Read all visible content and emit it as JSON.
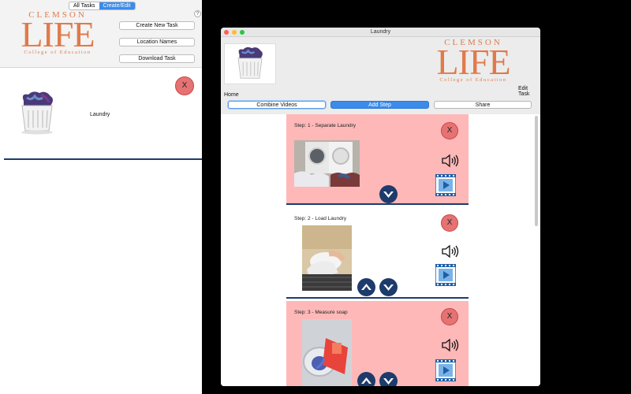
{
  "left_window": {
    "tabs": [
      {
        "label": "All Tasks",
        "active": false
      },
      {
        "label": "Create/Edit",
        "active": true
      }
    ],
    "help_label": "?",
    "logo": {
      "line1": "CLEMSON",
      "line2": "LIFE",
      "line3": "College of Education"
    },
    "buttons": {
      "create_new_task": "Create New Task",
      "location_names": "Location Names",
      "download_task": "Download Task"
    },
    "tasks": [
      {
        "name": "Laundry",
        "delete_label": "X"
      }
    ]
  },
  "right_window": {
    "window_title": "Laundry",
    "logo": {
      "line1": "CLEMSON",
      "line2": "LIFE",
      "line3": "College of Education"
    },
    "edit_task_label": "Edit Task",
    "home_label": "Home",
    "toolbar": {
      "combine_videos": "Combine Videos",
      "add_step": "Add Step",
      "share": "Share"
    },
    "steps": [
      {
        "title": "Step: 1 - Separate Laundry",
        "delete_label": "X",
        "highlighted": true
      },
      {
        "title": "Step: 2 - Load Laundry",
        "delete_label": "X",
        "highlighted": false
      },
      {
        "title": "Step: 3 - Measure soap",
        "delete_label": "X",
        "highlighted": true
      }
    ]
  },
  "colors": {
    "accent_blue": "#3b8bea",
    "logo_orange": "#e07a4a",
    "card_pink": "#ffb8b8",
    "divider_navy": "#1d3b6b",
    "delete_red": "#e57373"
  }
}
